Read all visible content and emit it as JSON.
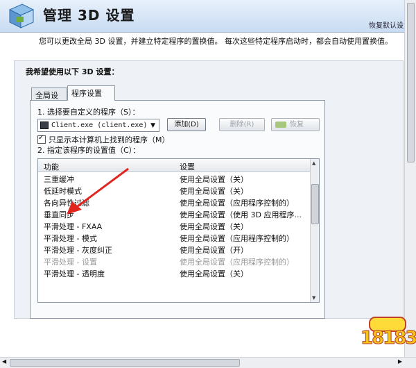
{
  "header": {
    "title": "管理 3D 设置",
    "restore_defaults": "恢复默认设置"
  },
  "description": "您可以更改全局 3D 设置，并建立特定程序的置换值。 每次这些特定程序启动时，都会自动使用置换值。",
  "group": {
    "title": "我希望使用以下 3D 设置：",
    "tabs": [
      {
        "label": "全局设置",
        "active": false
      },
      {
        "label": "程序设置",
        "active": true
      }
    ],
    "step1_label": "1. 选择要自定义的程序（S）：",
    "program_select": {
      "value": "Client.exe (client.exe)",
      "icon": "program-exe-icon"
    },
    "buttons": {
      "add": "添加(D)",
      "remove": "删除(R)",
      "restore": "恢复"
    },
    "checkbox": {
      "label": "只显示本计算机上找到的程序（M）",
      "checked": true
    },
    "step2_label": "2. 指定该程序的设置值（C）：",
    "table": {
      "columns": [
        "功能",
        "设置"
      ],
      "rows": [
        {
          "feature": "三重缓冲",
          "setting": "使用全局设置（关）",
          "dim": false
        },
        {
          "feature": "低延时模式",
          "setting": "使用全局设置（关）",
          "dim": false
        },
        {
          "feature": "各向异性过滤",
          "setting": "使用全局设置（应用程序控制的）",
          "dim": false
        },
        {
          "feature": "垂直同步",
          "setting": "使用全局设置（使用 3D 应用程序...",
          "dim": false
        },
        {
          "feature": "平滑处理 - FXAA",
          "setting": "使用全局设置（关）",
          "dim": false
        },
        {
          "feature": "平滑处理 - 模式",
          "setting": "使用全局设置（应用程序控制的）",
          "dim": false
        },
        {
          "feature": "平滑处理 - 灰度纠正",
          "setting": "使用全局设置（开）",
          "dim": false
        },
        {
          "feature": "平滑处理 - 设置",
          "setting": "使用全局设置（应用程序控制的）",
          "dim": true
        },
        {
          "feature": "平滑处理 - 透明度",
          "setting": "使用全局设置（关）",
          "dim": false
        }
      ]
    }
  },
  "watermark": {
    "text": "18183"
  },
  "colors": {
    "annotation_arrow": "#e0251f",
    "header_bg": "#d6e4f5"
  }
}
